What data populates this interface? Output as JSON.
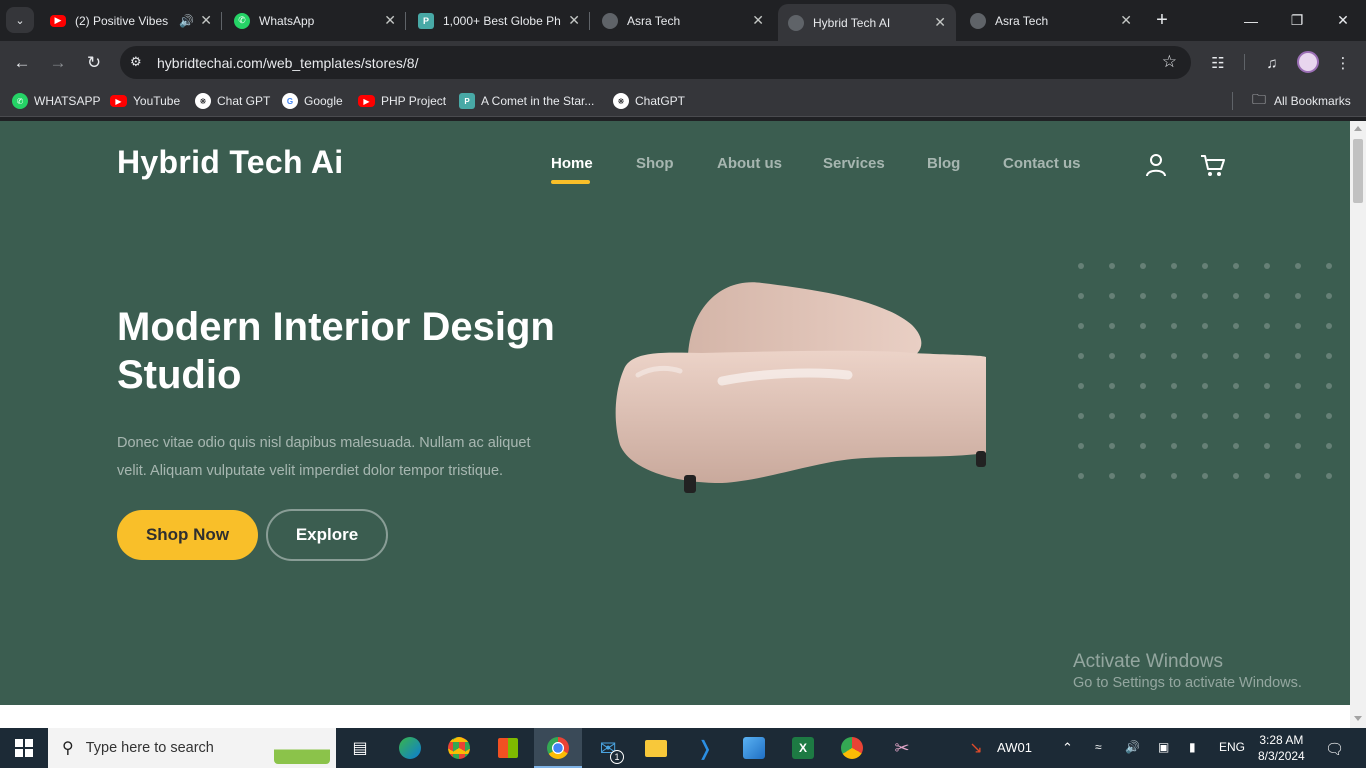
{
  "browser": {
    "tabs": [
      {
        "title": "(2) Positive Vibes",
        "favicon": "youtube-icon",
        "audio": true
      },
      {
        "title": "WhatsApp",
        "favicon": "whatsapp-icon"
      },
      {
        "title": "1,000+ Best Globe Ph",
        "favicon": "pixabay-icon"
      },
      {
        "title": "Asra Tech",
        "favicon": "globe-icon"
      },
      {
        "title": "Hybrid Tech AI",
        "favicon": "globe-icon",
        "active": true
      },
      {
        "title": "Asra Tech",
        "favicon": "globe-icon"
      }
    ],
    "url": "hybridtechai.com/web_templates/stores/8/",
    "bookmarks": [
      {
        "label": "WHATSAPP",
        "icon": "whatsapp-icon"
      },
      {
        "label": "YouTube",
        "icon": "youtube-icon"
      },
      {
        "label": "Chat GPT",
        "icon": "openai-icon"
      },
      {
        "label": "Google",
        "icon": "google-icon"
      },
      {
        "label": "PHP Project",
        "icon": "youtube-icon"
      },
      {
        "label": "A Comet in the Star...",
        "icon": "pixabay-icon"
      },
      {
        "label": "ChatGPT",
        "icon": "openai-icon"
      }
    ],
    "all_bookmarks": "All Bookmarks"
  },
  "site": {
    "brand": "Hybrid Tech Ai",
    "nav": [
      {
        "label": "Home",
        "active": true
      },
      {
        "label": "Shop"
      },
      {
        "label": "About us"
      },
      {
        "label": "Services"
      },
      {
        "label": "Blog"
      },
      {
        "label": "Contact us"
      }
    ],
    "hero": {
      "title": "Modern Interior Design Studio",
      "text": "Donec vitae odio quis nisl dapibus malesuada. Nullam ac aliquet velit. Aliquam vulputate velit imperdiet dolor tempor tristique.",
      "primary_button": "Shop Now",
      "secondary_button": "Explore"
    },
    "colors": {
      "background": "#3b5d50",
      "accent": "#f9bf29"
    }
  },
  "watermark": {
    "line1": "Activate Windows",
    "line2": "Go to Settings to activate Windows."
  },
  "taskbar": {
    "search_placeholder": "Type here to search",
    "mail_badge": "1",
    "tray_label": "AW01",
    "language": "ENG",
    "time": "3:28 AM",
    "date": "8/3/2024"
  }
}
